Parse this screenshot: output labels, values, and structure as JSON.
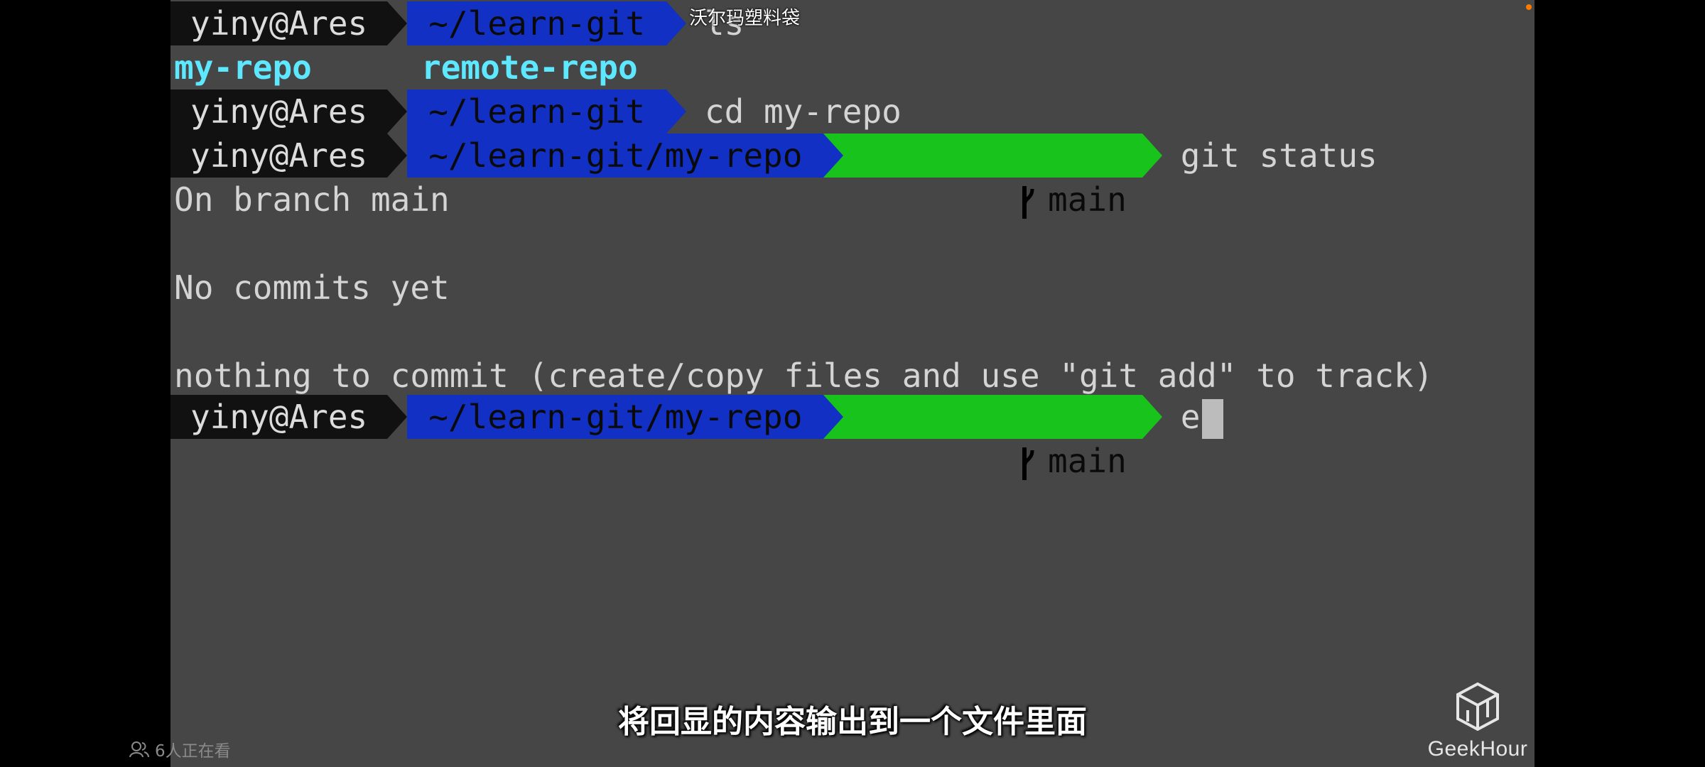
{
  "terminal": {
    "lines": [
      {
        "type": "prompt",
        "user": "yiny@Ares",
        "path": "~/learn-git",
        "branch": "",
        "command": "ls"
      },
      {
        "type": "dirs",
        "items": [
          "my-repo",
          "remote-repo"
        ]
      },
      {
        "type": "prompt",
        "user": "yiny@Ares",
        "path": "~/learn-git",
        "branch": "",
        "command": "cd my-repo"
      },
      {
        "type": "prompt",
        "user": "yiny@Ares",
        "path": "~/learn-git/my-repo",
        "branch": "main",
        "command": "git status"
      },
      {
        "type": "output",
        "text": "On branch main"
      },
      {
        "type": "output",
        "text": ""
      },
      {
        "type": "output",
        "text": "No commits yet"
      },
      {
        "type": "output",
        "text": ""
      },
      {
        "type": "output",
        "text": "nothing to commit (create/copy files and use \"git add\" to track)"
      },
      {
        "type": "prompt",
        "user": "yiny@Ares",
        "path": "~/learn-git/my-repo",
        "branch": "main",
        "command": "e",
        "cursor": true
      }
    ]
  },
  "overlay": {
    "ad_text": "沃尔玛塑料袋",
    "subtitle": "将回显的内容输出到一个文件里面",
    "viewers": "6人正在看",
    "logo_text": "GeekHour"
  },
  "colors": {
    "terminal_bg": "#464646",
    "user_segment": "#111111",
    "path_segment": "#1230c4",
    "git_segment": "#18c41c",
    "directory_text": "#5ee8ff"
  },
  "icons": {
    "branch": "git-branch-icon",
    "viewers": "viewers-icon",
    "logo": "geekhour-logo-icon"
  }
}
